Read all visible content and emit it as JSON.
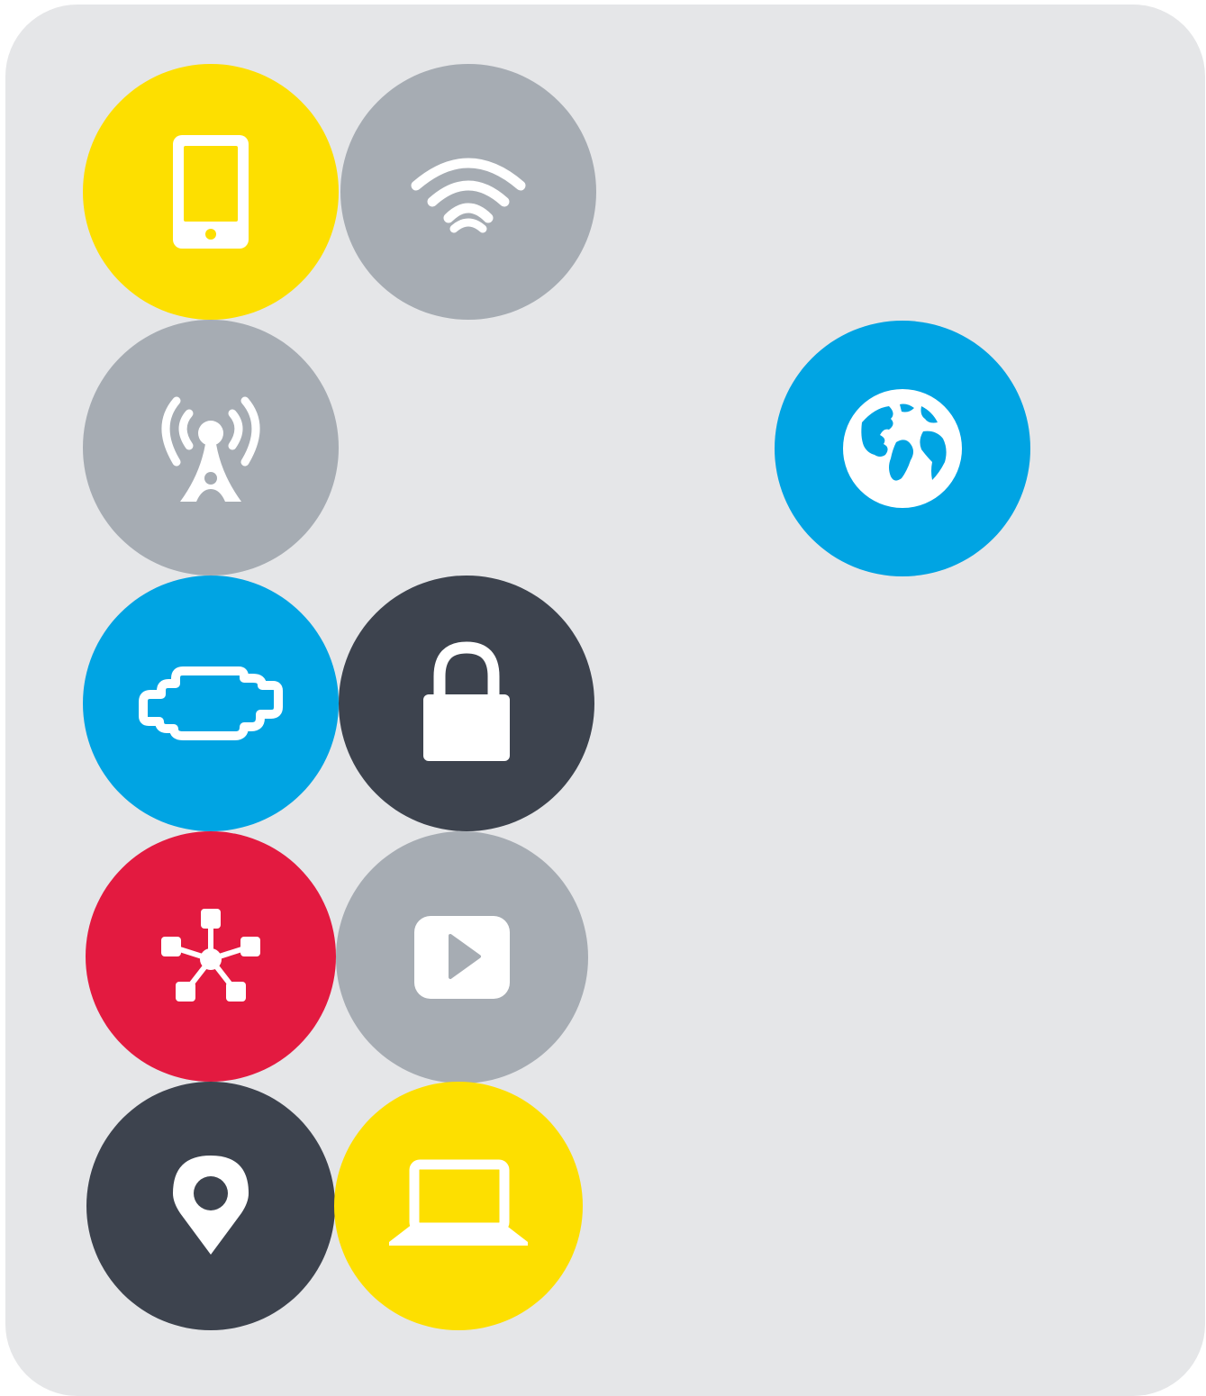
{
  "colors": {
    "background": "#e5e6e8",
    "yellow": "#fddf00",
    "gray": "#a6acb3",
    "blue": "#00a4e3",
    "dark": "#3d434e",
    "red": "#e31a40",
    "white": "#ffffff"
  },
  "tiles": [
    {
      "icon": "smartphone-icon",
      "color": "yellow"
    },
    {
      "icon": "wifi-icon",
      "color": "gray"
    },
    {
      "icon": "radio-tower-icon",
      "color": "gray"
    },
    {
      "icon": "globe-icon",
      "color": "blue"
    },
    {
      "icon": "engine-icon",
      "color": "blue"
    },
    {
      "icon": "lock-icon",
      "color": "dark"
    },
    {
      "icon": "network-hub-icon",
      "color": "red"
    },
    {
      "icon": "video-play-icon",
      "color": "gray"
    },
    {
      "icon": "location-pin-icon",
      "color": "dark"
    },
    {
      "icon": "laptop-icon",
      "color": "yellow"
    }
  ]
}
